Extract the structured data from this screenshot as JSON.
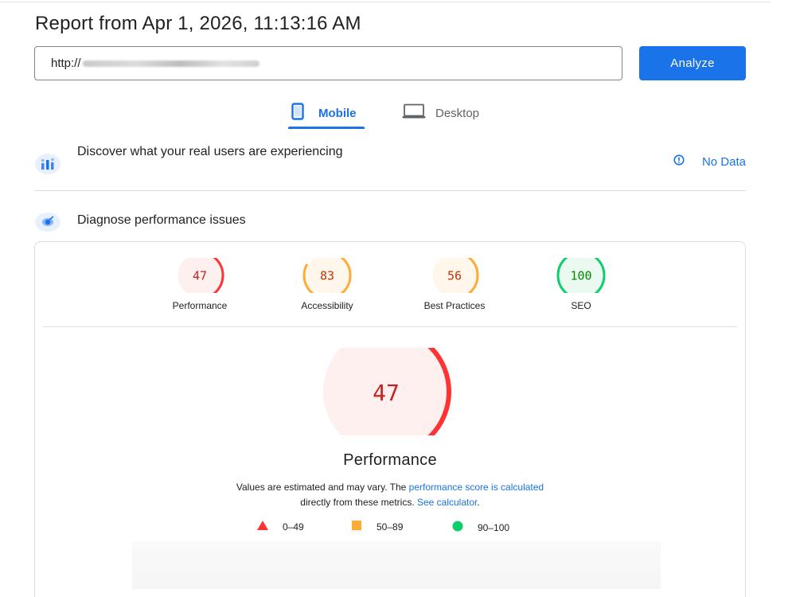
{
  "report": {
    "title": "Report from Apr 1, 2026, 11:13:16 AM"
  },
  "url_input": {
    "value": "http://"
  },
  "analyze_button": {
    "label": "Analyze",
    "color": "#1a73e8"
  },
  "tabs": [
    {
      "label": "Mobile",
      "icon": "phone-icon",
      "selected": true
    },
    {
      "label": "Desktop",
      "icon": "laptop-icon",
      "selected": false
    }
  ],
  "field_data": {
    "heading": "Discover what your real users are experiencing",
    "status": "No Data",
    "icon": "users-chart-icon",
    "status_icon": "info-icon"
  },
  "lab_data": {
    "heading": "Diagnose performance issues",
    "icon": "lighthouse-icon"
  },
  "scores": [
    {
      "label": "Performance",
      "value": "47",
      "score": 0.47,
      "rating": "fail"
    },
    {
      "label": "Accessibility",
      "value": "83",
      "score": 0.83,
      "rating": "average"
    },
    {
      "label": "Best Practices",
      "value": "56",
      "score": 0.56,
      "rating": "average"
    },
    {
      "label": "SEO",
      "value": "100",
      "score": 1.0,
      "rating": "pass"
    }
  ],
  "main_gauge": {
    "value": "47",
    "score": 0.47,
    "label": "Performance"
  },
  "description": {
    "text1": "Values are estimated and may vary. The ",
    "link1": "performance score is calculated",
    "text2": "directly from these metrics. ",
    "link2": "See calculator",
    "text3": "."
  },
  "legend": [
    {
      "range": "0–49",
      "shape": "triangle",
      "color": "#ff3333"
    },
    {
      "range": "50–89",
      "shape": "square",
      "color": "#ffaa33"
    },
    {
      "range": "90–100",
      "shape": "circle",
      "color": "#0cce6b"
    }
  ],
  "colors": {
    "fail": "#ff3333",
    "fail_bg": "#fff0f0",
    "fail_text": "#c7221f",
    "average": "#ffaa33",
    "average_bg": "#fff7ec",
    "average_text": "#c33300",
    "pass": "#0cce6b",
    "pass_bg": "#eafaf1",
    "pass_text": "#008800",
    "accent": "#1a73e8"
  }
}
